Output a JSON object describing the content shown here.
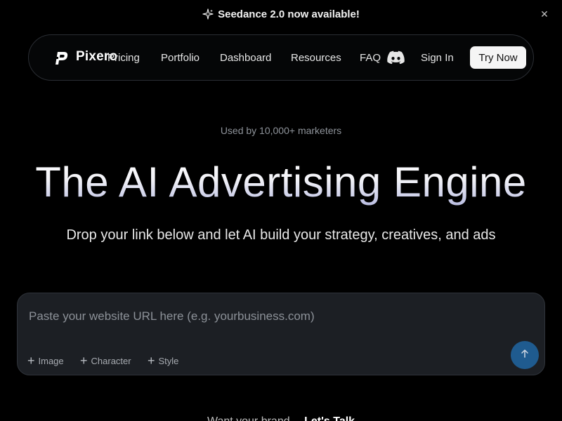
{
  "banner": {
    "text": "Seedance 2.0 now available!",
    "close_symbol": "✕",
    "icons": [
      "sparkle-icon",
      "close-icon"
    ]
  },
  "nav": {
    "logo_text": "Pixero",
    "links": [
      {
        "label": "Pricing"
      },
      {
        "label": "Portfolio"
      },
      {
        "label": "Dashboard"
      },
      {
        "label": "Resources"
      },
      {
        "label": "FAQ"
      }
    ],
    "discord_icon": "discord-icon",
    "sign_in": "Sign In",
    "try_now": "Try Now"
  },
  "hero": {
    "eyebrow": "Used by 10,000+ marketers",
    "title": "The AI Advertising Engine",
    "subtitle": "Drop your link below and let AI build your strategy, creatives, and ads"
  },
  "url_box": {
    "placeholder": "Paste your website URL here (e.g. yourbusiness.com)",
    "value": "",
    "chips": [
      {
        "label": "Image"
      },
      {
        "label": "Character"
      },
      {
        "label": "Style"
      }
    ],
    "submit_icon": "arrow-up-icon"
  },
  "bottom": {
    "text_start": "Want your brand…",
    "text_bold": "Let's Talk"
  },
  "colors": {
    "background": "#000000",
    "card": "#1c1f24",
    "submit": "#1f5b8f",
    "cta": "#f5f5f5"
  }
}
